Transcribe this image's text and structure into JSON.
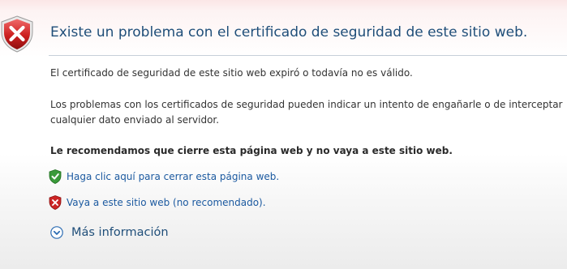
{
  "header": {
    "icon": "error-shield-icon",
    "title": "Existe un problema con el certificado de seguridad de este sitio web."
  },
  "body": {
    "expired_text": "El certificado de seguridad de este sitio web expiró o todavía no es válido.",
    "problems_line1": "Los problemas con los certificados de seguridad pueden indicar un intento de engañarle o de interceptar",
    "problems_line2": "cualquier dato enviado al servidor.",
    "recommendation": "Le recomendamos que cierre esta página web y no vaya a este sitio web."
  },
  "actions": {
    "close_page": {
      "icon": "green-check-shield-icon",
      "label": "Haga clic aquí para cerrar esta página web."
    },
    "continue_site": {
      "icon": "red-x-shield-icon",
      "label": "Vaya a este sitio web (no recomendado)."
    },
    "more_info": {
      "icon": "chevron-down-circle-icon",
      "label": "Más información"
    }
  },
  "colors": {
    "title": "#1f4e79",
    "link": "#1c5aa0",
    "error_red": "#c61f1f",
    "safe_green": "#2c8a2c"
  }
}
